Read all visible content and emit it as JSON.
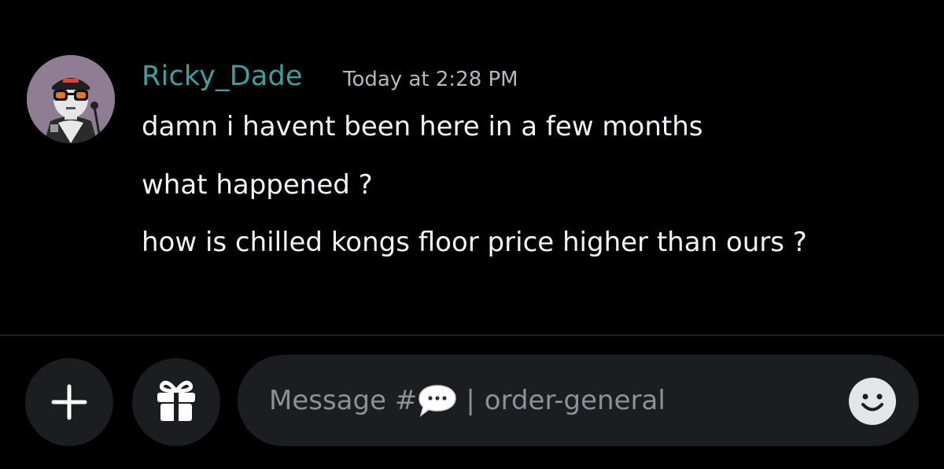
{
  "message": {
    "author": "Ricky_Dade",
    "author_color": "#3aa0a0",
    "timestamp": "Today at 2:28 PM",
    "lines": [
      "damn i havent been here in a few months",
      "what happened ?",
      "how is chilled kongs floor price higher than ours ?"
    ]
  },
  "composer": {
    "placeholder_prefix": "Message #",
    "separator": "|",
    "channel_name": "order-general",
    "plus_icon": "plus-icon",
    "gift_icon": "gift-icon",
    "channel_emoji_icon": "speech-balloon-icon",
    "emoji_icon": "smiley-icon"
  },
  "colors": {
    "background": "#000000",
    "surface": "#1c1d21",
    "placeholder": "#8e9097"
  }
}
